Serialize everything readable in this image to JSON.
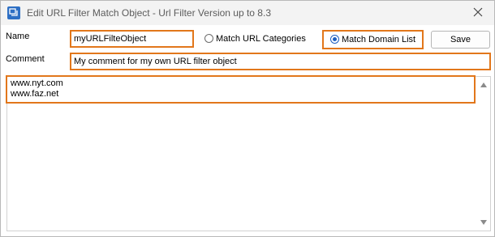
{
  "window": {
    "title": "Edit URL Filter Match Object - Url Filter Version up to 8.3"
  },
  "form": {
    "name_label": "Name",
    "name_value": "myURLFilteObject",
    "comment_label": "Comment",
    "comment_value": "My comment for my own URL filter object",
    "radio_categories_label": "Match URL Categories",
    "radio_domain_label": "Match Domain List",
    "selected_option": "Match Domain List",
    "save_label": "Save"
  },
  "domain_list": {
    "line_1": "www.nyt.com",
    "line_2": "www.faz.net"
  },
  "colors": {
    "highlight": "#e2771b",
    "radio_selected": "#1f5fbf"
  },
  "icons": {
    "app": "filter-app-icon",
    "close": "close-icon"
  }
}
